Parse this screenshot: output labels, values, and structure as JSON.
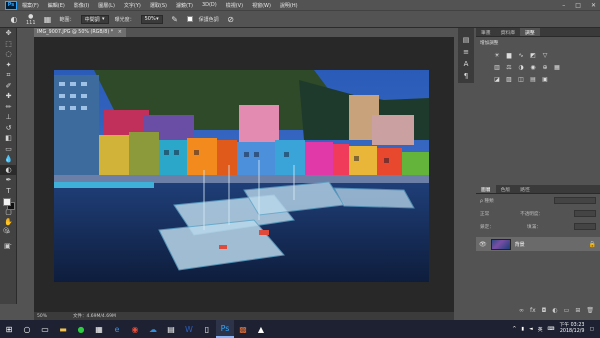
{
  "menu": [
    "檔案(F)",
    "編輯(E)",
    "影像(I)",
    "圖層(L)",
    "文字(Y)",
    "選取(S)",
    "濾鏡(T)",
    "3D(D)",
    "檢視(V)",
    "視窗(W)",
    "說明(H)"
  ],
  "app_logo": "Ps",
  "options": {
    "brush_size": "111",
    "range_label": "範圍：",
    "range_value": "中間調",
    "exposure_label": "曝光度：",
    "exposure_value": "50%",
    "protect_label": "保護色調"
  },
  "document": {
    "tab_title": "IMG_9007.JPG @ 50% (RGB/8) *",
    "zoom": "50%",
    "file_info": "文件：4.69M/4.69M"
  },
  "panels": {
    "top_tabs": [
      "筆畫",
      "資料庫",
      "調整"
    ],
    "adjust_title": "增加調整",
    "layer_tabs": [
      "圖層",
      "色版",
      "路徑"
    ],
    "kind_label": "ρ 種類",
    "normal": "正常",
    "opacity": "不透明度：",
    "lock": "鎖定：",
    "fill": "填滿：",
    "layer_name": "背景"
  },
  "taskbar": {
    "time": "下午 03:23",
    "date": "2018/12/9",
    "ime": "英"
  },
  "icons": {
    "colors": {
      "accent": "#31a8ff",
      "panel": "#535353",
      "canvas": "#282828"
    }
  }
}
